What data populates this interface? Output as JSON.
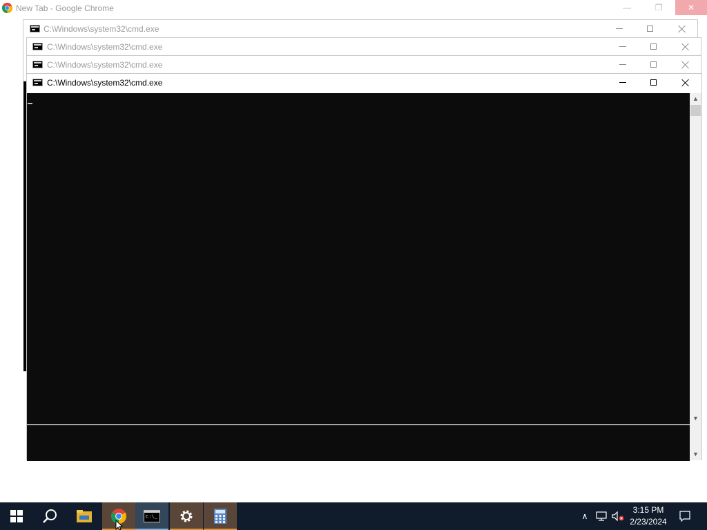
{
  "chrome": {
    "title": "New Tab - Google Chrome"
  },
  "cmd_windows": [
    {
      "title": "C:\\Windows\\system32\\cmd.exe"
    },
    {
      "title": "C:\\Windows\\system32\\cmd.exe"
    },
    {
      "title": "C:\\Windows\\system32\\cmd.exe"
    },
    {
      "title": "C:\\Windows\\system32\\cmd.exe"
    }
  ],
  "taskbar": {
    "items": [
      "start-icon",
      "search-icon",
      "file-explorer-icon",
      "chrome-icon",
      "cmd-icon",
      "settings-icon",
      "calculator-icon"
    ],
    "clock": {
      "time": "3:15 PM",
      "date": "2/23/2024"
    }
  },
  "colors": {
    "taskbar": "#101c2c",
    "console": "#0c0c0c",
    "accent_orange": "#e0923c",
    "chrome_close": "#f1a9ad"
  }
}
